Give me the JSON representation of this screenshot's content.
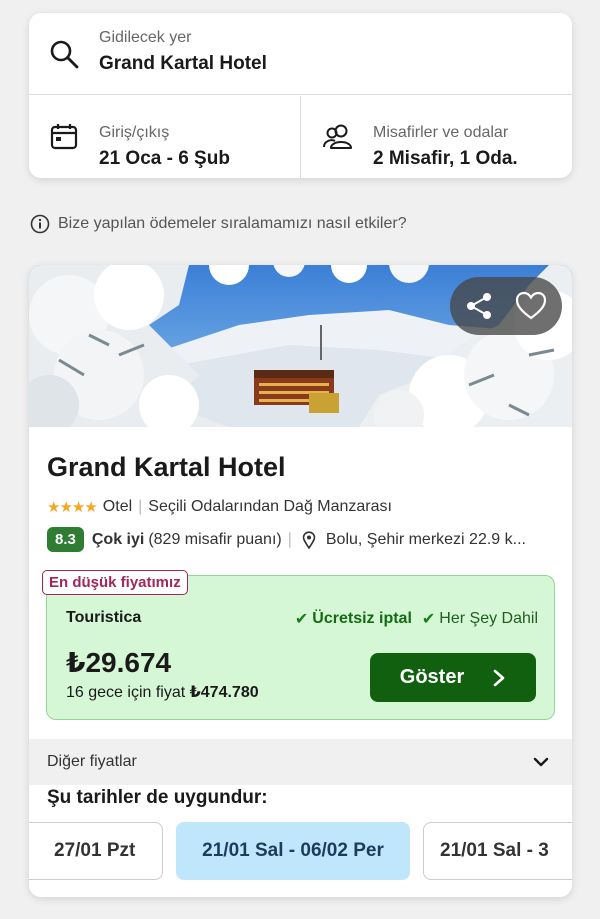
{
  "search": {
    "destination_label": "Gidilecek yer",
    "destination_value": "Grand Kartal Hotel",
    "dates_label": "Giriş/çıkış",
    "dates_value": "21 Oca - 6 Şub",
    "guests_label": "Misafirler ve odalar",
    "guests_value": "2 Misafir, 1 Oda."
  },
  "info_text": "Bize yapılan ödemeler sıralamamızı nasıl etkiler?",
  "hotel": {
    "name": "Grand Kartal Hotel",
    "stars": "★★★★",
    "type": "Otel",
    "feature": "Seçili Odalarından Dağ Manzarası",
    "score": "8.3",
    "score_label": "Çok iyi",
    "review_count": "(829 misafir puanı)",
    "location": "Bolu, Şehir merkezi 22.9 k...",
    "lowest_badge": "En düşük fiyatımız",
    "provider": "Touristica",
    "perk1": "Ücretsiz iptal",
    "perk2": "Her Şey Dahil",
    "price": "₺29.674",
    "price_sub_prefix": "16 gece için fiyat",
    "price_total": "₺474.780",
    "show_button": "Göster",
    "other_prices": "Diğer fiyatlar",
    "available_dates_title": "Şu tarihler de uygundur:",
    "dates": [
      "27/01 Pzt",
      "21/01 Sal - 06/02 Per",
      "21/01 Sal - 3"
    ]
  },
  "colors": {
    "accent_green": "#106010",
    "score_green": "#2e7d32",
    "price_box": "#d6f7d6",
    "badge": "#a0265b",
    "selected_date": "#bfe6fb"
  }
}
